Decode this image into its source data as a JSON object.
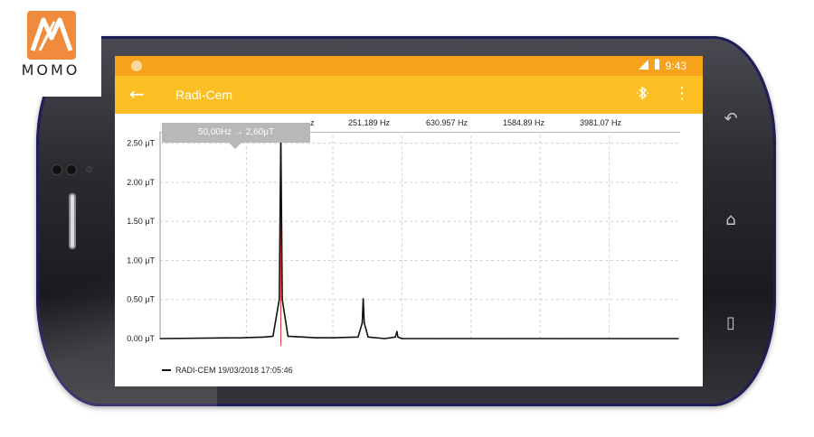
{
  "watermark": {
    "text": "MOMO",
    "colors": {
      "orange": "#f08a3c",
      "white": "#ffffff"
    }
  },
  "statusbar": {
    "time": "9:43",
    "icons": [
      "signal-icon",
      "battery-icon"
    ],
    "color": "#f7a21b"
  },
  "appbar": {
    "title": "Radi-Cem",
    "back_icon": "arrow-left-icon",
    "bluetooth_icon": "bluetooth-icon",
    "menu_icon": "overflow-menu-icon",
    "color": "#fbbf24"
  },
  "chart": {
    "tooltip": "50,00Hz → 2,60μT",
    "header_ticks": [
      "z",
      "251.189 Hz",
      "630.957 Hz",
      "1584.89 Hz",
      "3981.07 Hz"
    ],
    "legend": "RADI-CEM 19/03/2018 17:05:46"
  },
  "chart_data": {
    "type": "line",
    "xlabel": "",
    "ylabel": "",
    "x_ticks": [
      "251.189 Hz",
      "630.957 Hz",
      "1584.89 Hz",
      "3981.07 Hz"
    ],
    "y_ticks": [
      "2.50 μT",
      "2.00 μT",
      "1.50 μT",
      "1.00 μT",
      "0.50 μT",
      "0.00 μT"
    ],
    "y_tick_values": [
      2.5,
      2.0,
      1.5,
      1.0,
      0.5,
      0.0
    ],
    "ylim": [
      0,
      2.6
    ],
    "x_scale": "log",
    "xlim": [
      10,
      10000
    ],
    "grid": true,
    "series": [
      {
        "name": "RADI-CEM 19/03/2018 17:05:46",
        "x": [
          10,
          30,
          40,
          45,
          49,
          50,
          51,
          55,
          80,
          100,
          140,
          148,
          150,
          152,
          160,
          200,
          230,
          235,
          238,
          250,
          400,
          1000,
          2000,
          5000,
          10000
        ],
        "y": [
          0.0,
          0.01,
          0.02,
          0.03,
          0.5,
          2.6,
          0.5,
          0.03,
          0.01,
          0.01,
          0.02,
          0.2,
          0.51,
          0.2,
          0.02,
          0.0,
          0.02,
          0.09,
          0.02,
          0.0,
          0.0,
          0.0,
          0.0,
          0.0,
          0.0
        ]
      }
    ],
    "marker_x": 50,
    "line_color": "#111111",
    "marker_color": "#e53935"
  },
  "nav_buttons": [
    "recent-apps-icon",
    "home-icon",
    "back-nav-icon"
  ]
}
